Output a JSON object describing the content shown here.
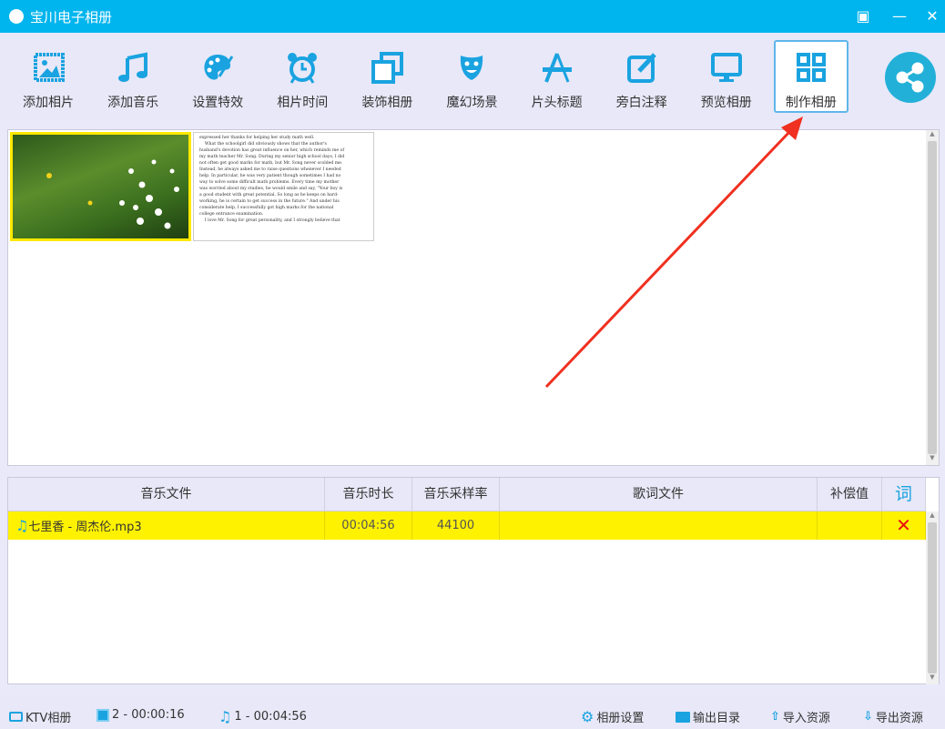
{
  "window": {
    "title": "宝川电子相册"
  },
  "toolbar": {
    "items": [
      {
        "label": "添加相片",
        "icon": "image-icon"
      },
      {
        "label": "添加音乐",
        "icon": "music-note-icon"
      },
      {
        "label": "设置特效",
        "icon": "palette-icon"
      },
      {
        "label": "相片时间",
        "icon": "alarm-clock-icon"
      },
      {
        "label": "装饰相册",
        "icon": "layers-icon"
      },
      {
        "label": "魔幻场景",
        "icon": "theater-mask-icon"
      },
      {
        "label": "片头标题",
        "icon": "title-icon"
      },
      {
        "label": "旁白注释",
        "icon": "edit-icon"
      },
      {
        "label": "预览相册",
        "icon": "monitor-icon"
      },
      {
        "label": "制作相册",
        "icon": "grid-icon"
      }
    ],
    "selected": 9
  },
  "photos": {
    "text_thumb_lines": [
      "expressed her thanks for helping her study math well.",
      "    What the schoolgirl did obviously shows that the author's",
      "husband's devotion has great influence on her, which reminds me of",
      "my math teacher Mr. Song. During my senior high school days, I did",
      "not often get good marks for math, but Mr. Song never scolded me.",
      "Instead, he always asked me to raise questions whenever I needed",
      "help. In particular, he was very patient though sometimes I had no",
      "way to solve some difficult math problems. Every time my mother",
      "was worried about my studies, he would smile and say, \"Your boy is",
      "a good student with great potential. So long as he keeps on hard-",
      "working, he is certain to get success in the future.\" And under his",
      "considerate help, I successfully got high marks for the national",
      "college entrance examination.",
      "    I love Mr. Song for great personality, and I strongly believe that"
    ]
  },
  "music": {
    "headers": [
      "音乐文件",
      "音乐时长",
      "音乐采样率",
      "歌词文件",
      "补偿值",
      "词"
    ],
    "rows": [
      {
        "file": "七里香 - 周杰伦.mp3",
        "duration": "00:04:56",
        "sample_rate": "44100",
        "lyrics": "",
        "offset": "",
        "delete": "✕"
      }
    ]
  },
  "status": {
    "ktv": "KTV相册",
    "photos": "2 - 00:00:16",
    "music": "1 - 00:04:56",
    "settings": "相册设置",
    "output": "输出目录",
    "import": "导入资源",
    "export": "导出资源"
  },
  "colors": {
    "accent": "#00b5ee",
    "icon": "#1aa3e0",
    "highlight_row": "#fff200",
    "arrow": "#f03020"
  }
}
